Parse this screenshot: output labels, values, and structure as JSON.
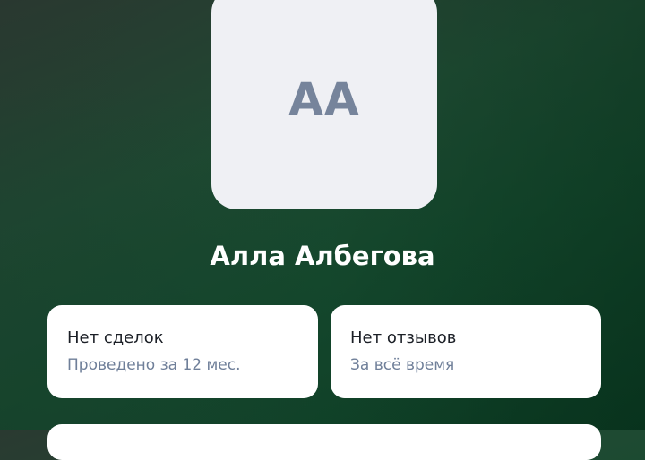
{
  "profile": {
    "initials": "АА",
    "name": "Алла Албегова"
  },
  "stats": {
    "deals": {
      "title": "Нет сделок",
      "subtitle": "Проведено за 12 мес."
    },
    "reviews": {
      "title": "Нет отзывов",
      "subtitle": "За всё время"
    }
  },
  "colors": {
    "background_dark_green": "#14472c",
    "card": "#ffffff",
    "avatar_bg": "#eff0f4",
    "avatar_text": "#76849b",
    "subtitle": "#6f7f99"
  }
}
